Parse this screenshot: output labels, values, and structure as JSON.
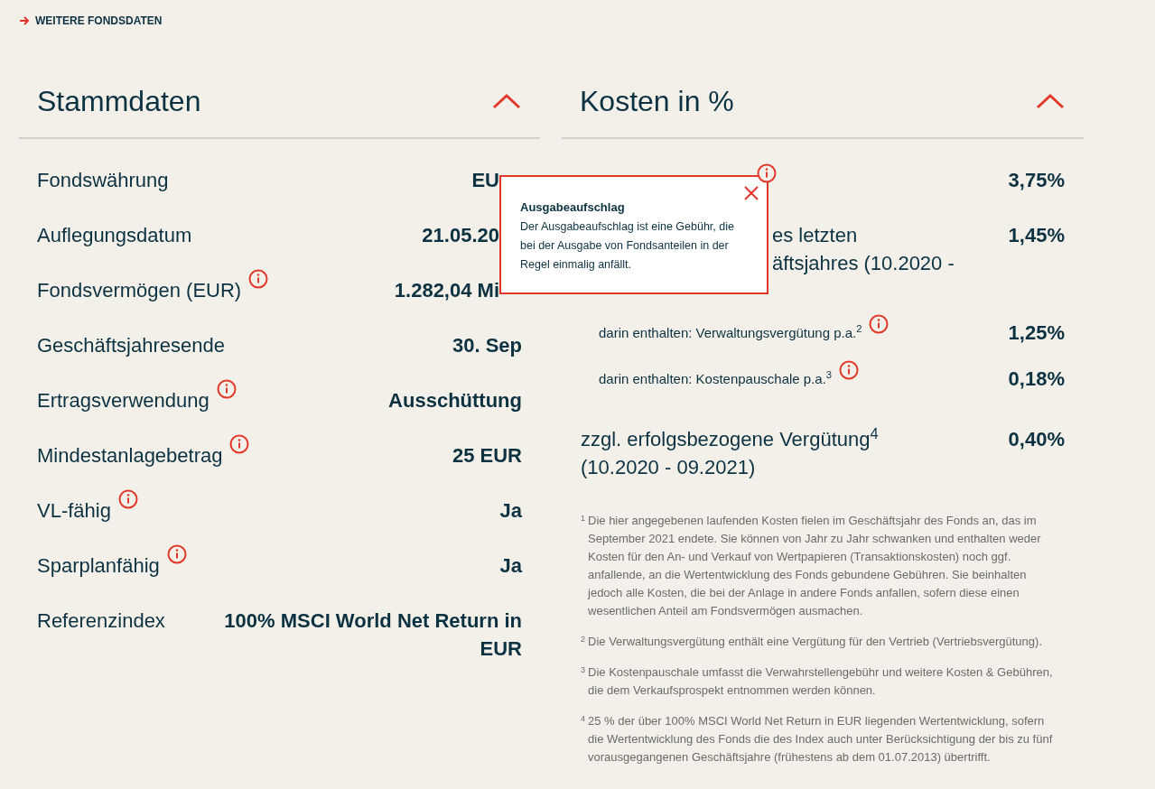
{
  "link": {
    "label": "WEITERE FONDSDATEN"
  },
  "stammdaten": {
    "title": "Stammdaten",
    "expanded": true,
    "rows": [
      {
        "label": "Fondswährung",
        "value": "EU",
        "info": false,
        "occluded": true
      },
      {
        "label": "Auflegungsdatum",
        "value": "21.05.20",
        "info": false,
        "occluded": true
      },
      {
        "label": "Fondsvermögen (EUR)",
        "value": "1.282,04 Mi",
        "info": true,
        "occluded": true
      },
      {
        "label": "Geschäftsjahresende",
        "value": "30. Sep",
        "info": false,
        "occluded": false
      },
      {
        "label": "Ertragsverwendung",
        "value": "Ausschüttung",
        "info": true,
        "occluded": false
      },
      {
        "label": "Mindestanlagebetrag",
        "value": "25 EUR",
        "info": true,
        "occluded": false
      },
      {
        "label": "VL-fähig",
        "value": "Ja",
        "info": true,
        "occluded": false
      },
      {
        "label": "Sparplanfähig",
        "value": "Ja",
        "info": true,
        "occluded": false
      },
      {
        "label": "Referenzindex",
        "value": "100% MSCI World Net Return in EUR",
        "info": false,
        "occluded": false
      }
    ]
  },
  "kosten": {
    "title": "Kosten in %",
    "expanded": true,
    "rows": [
      {
        "kind": "main",
        "label_fragments": [],
        "value": "3,75%",
        "info": true
      },
      {
        "kind": "main",
        "label_fragments": [
          "es letzten",
          "äftsjahres (10.2020 -"
        ],
        "value": "1,45%",
        "info": false
      },
      {
        "kind": "sub",
        "label": "darin enthalten: Verwaltungsvergütung p.a.$^{2}$",
        "value": "1,25%",
        "info": true
      },
      {
        "kind": "sub",
        "label": "darin enthalten: Kostenpauschale p.a.$^{3}$",
        "value": "0,18%",
        "info": true
      },
      {
        "kind": "main",
        "label": "zzgl. erfolgsbezogene Vergütung$^{4}$ (10.2020 - 09.2021)",
        "value": "0,40%",
        "info": false
      }
    ],
    "footnotes": [
      {
        "mark": "1",
        "text": "Die hier angegebenen laufenden Kosten fielen im Geschäftsjahr des Fonds an, das im September 2021 endete. Sie können von Jahr zu Jahr schwanken und enthalten weder Kosten für den An- und Verkauf von Wertpapieren (Transaktionskosten) noch ggf. anfallende, an die Wertentwicklung des Fonds gebundene Gebühren. Sie beinhalten jedoch alle Kosten, die bei der Anlage in andere Fonds anfallen, sofern diese einen wesentlichen Anteil am Fondsvermögen ausmachen."
      },
      {
        "mark": "2",
        "text": "Die Verwaltungsvergütung enthält eine Vergütung für den Vertrieb (Vertriebsvergütung)."
      },
      {
        "mark": "3",
        "text": "Die Kostenpauschale umfasst die Verwahrstellengebühr und weitere Kosten & Gebühren, die dem Verkaufsprospekt entnommen werden können."
      },
      {
        "mark": "4",
        "text": "25 % der über 100% MSCI World Net Return in EUR liegenden Wertentwicklung, sofern die Wertentwicklung des Fonds die des Index auch unter Berücksichtigung der bis zu fünf vorausgegangenen Geschäftsjahre (frühestens ab dem 01.07.2013) übertrifft."
      }
    ]
  },
  "tooltip": {
    "title": "Ausgabeaufschlag",
    "text": "Der Ausgabeaufschlag ist eine Gebühr, die bei der Ausgabe von Fondsanteilen in der Regel einmalig anfällt."
  }
}
